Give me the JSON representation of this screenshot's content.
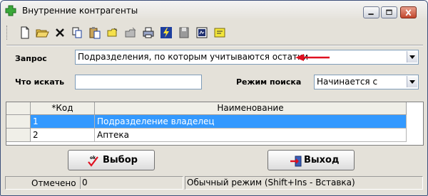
{
  "window": {
    "title": "Внутренние контрагенты"
  },
  "toolbar": {
    "buttons": [
      "new-document",
      "open-folder",
      "delete",
      "copy",
      "paste",
      "folder-yellow",
      "folder-gray",
      "print",
      "lightning",
      "save-disk",
      "report",
      "note"
    ]
  },
  "query": {
    "label": "Запрос",
    "value": "Подразделения, по которым учитываются остатки"
  },
  "search": {
    "label": "Что искать",
    "value": "",
    "mode_label": "Режим поиска",
    "mode_value": "Начинается с"
  },
  "table": {
    "columns": [
      "*Код",
      "Наименование"
    ],
    "rows": [
      {
        "code": "1",
        "name": "Подразделение владелец",
        "selected": true
      },
      {
        "code": "2",
        "name": "Аптека",
        "selected": false
      }
    ]
  },
  "buttons": {
    "choose_label": "Выбор",
    "exit_label": "Выход"
  },
  "statusbar": {
    "marked_label": "Отмечено",
    "marked_count": "0",
    "mode_text": "Обычный режим (Shift+Ins - Вставка)"
  },
  "colors": {
    "selection": "#3399ff",
    "arrow": "#e01020",
    "close_button": "#c2462c"
  }
}
